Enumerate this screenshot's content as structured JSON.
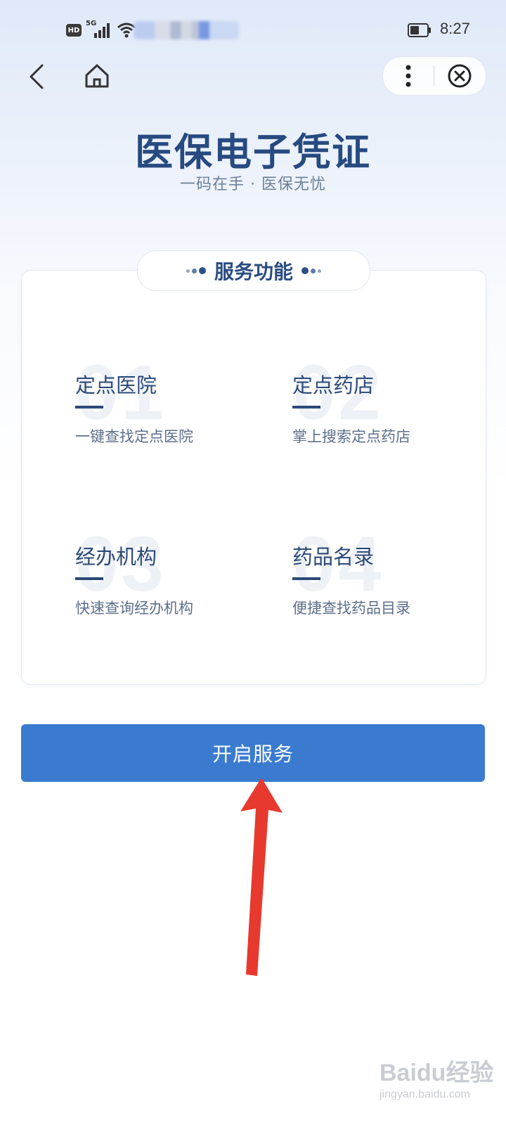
{
  "status_bar": {
    "hd_label": "HD",
    "network_label": "5G",
    "time": "8:27"
  },
  "nav": {
    "back_icon": "chevron-left-icon",
    "home_icon": "home-icon",
    "more_icon": "more-vertical-icon",
    "close_icon": "close-circle-icon"
  },
  "header": {
    "title": "医保电子凭证",
    "subtitle": "一码在手 · 医保无忧"
  },
  "services": {
    "section_title": "服务功能",
    "items": [
      {
        "number": "01",
        "title": "定点医院",
        "description": "一键查找定点医院"
      },
      {
        "number": "02",
        "title": "定点药店",
        "description": "掌上搜索定点药店"
      },
      {
        "number": "03",
        "title": "经办机构",
        "description": "快速查询经办机构"
      },
      {
        "number": "04",
        "title": "药品名录",
        "description": "便捷查找药品目录"
      }
    ]
  },
  "actions": {
    "start_label": "开启服务"
  },
  "colors": {
    "primary_blue": "#3a7bd0",
    "heading_navy": "#274a80",
    "annotation_red": "#e8392f"
  },
  "watermark": {
    "logo_text": "Baidu经验",
    "url": "jingyan.baidu.com"
  }
}
